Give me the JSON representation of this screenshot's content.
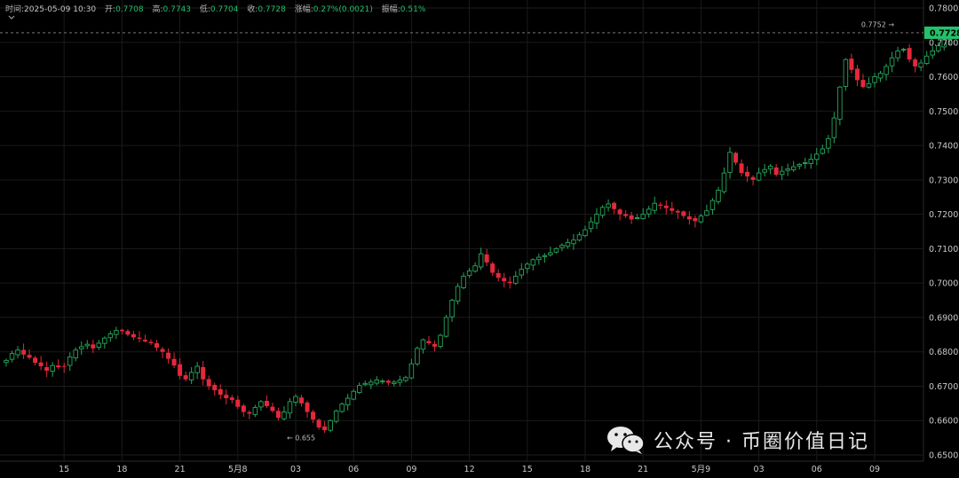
{
  "info_bar": {
    "time_label": "时间:",
    "time_value": "2025-05-09 10:30",
    "open_label": "开:",
    "open_value": "0.7708",
    "high_label": "高:",
    "high_value": "0.7743",
    "low_label": "低:",
    "low_value": "0.7704",
    "close_label": "收:",
    "close_value": "0.7728",
    "change_label": "涨幅:",
    "change_value": "0.27%(0.0021)",
    "amp_label": "振幅:",
    "amp_value": "0.51%"
  },
  "collapse_icon": "chevron-down-icon",
  "watermark": {
    "icon": "wechat-icon",
    "text": "公众号 · 币圈价值日记"
  },
  "colors": {
    "up": "#26a65b",
    "down": "#e3293a",
    "background": "#000000",
    "grid": "#1b1b1b",
    "axis_text": "#c8c8c8",
    "price_tag": "#26c06b"
  },
  "chart_data": {
    "type": "candlestick",
    "title": "",
    "xlabel": "",
    "ylabel": "",
    "ylim": [
      0.65,
      0.78
    ],
    "yticks": [
      "0.6500",
      "0.6600",
      "0.6700",
      "0.6800",
      "0.6900",
      "0.7000",
      "0.7100",
      "0.7200",
      "0.7300",
      "0.7400",
      "0.7500",
      "0.7600",
      "0.7700",
      "0.7800"
    ],
    "xticks": [
      {
        "label": "15",
        "index": 10
      },
      {
        "label": "18",
        "index": 20
      },
      {
        "label": "21",
        "index": 30
      },
      {
        "label": "5月8",
        "index": 40
      },
      {
        "label": "03",
        "index": 50
      },
      {
        "label": "06",
        "index": 60
      },
      {
        "label": "09",
        "index": 70
      },
      {
        "label": "12",
        "index": 80
      },
      {
        "label": "15",
        "index": 90
      },
      {
        "label": "18",
        "index": 100
      },
      {
        "label": "21",
        "index": 110
      },
      {
        "label": "5月9",
        "index": 120
      },
      {
        "label": "03",
        "index": 130
      },
      {
        "label": "06",
        "index": 140
      },
      {
        "label": "09",
        "index": 150
      }
    ],
    "current_price": "0.7728",
    "annotations": [
      {
        "text": "0.7752",
        "arrow": "→",
        "index": 154,
        "value": 0.7752
      },
      {
        "text": "0.655",
        "arrow": "←",
        "index": 48,
        "value": 0.655
      }
    ],
    "grid": true,
    "closes": [
      0.6775,
      0.6795,
      0.6805,
      0.6792,
      0.6783,
      0.6768,
      0.6758,
      0.6745,
      0.676,
      0.6755,
      0.6758,
      0.6785,
      0.6805,
      0.6815,
      0.6822,
      0.681,
      0.6825,
      0.684,
      0.6852,
      0.6862,
      0.686,
      0.685,
      0.6842,
      0.6838,
      0.683,
      0.6825,
      0.6812,
      0.68,
      0.678,
      0.676,
      0.673,
      0.672,
      0.674,
      0.6758,
      0.672,
      0.67,
      0.6688,
      0.6675,
      0.6665,
      0.666,
      0.664,
      0.6625,
      0.662,
      0.6638,
      0.6655,
      0.6642,
      0.6628,
      0.6608,
      0.6625,
      0.6655,
      0.667,
      0.665,
      0.6625,
      0.6603,
      0.658,
      0.6572,
      0.66,
      0.6628,
      0.6648,
      0.6665,
      0.6685,
      0.6702,
      0.6708,
      0.6712,
      0.6718,
      0.6715,
      0.671,
      0.6712,
      0.6718,
      0.6725,
      0.6765,
      0.681,
      0.6835,
      0.6825,
      0.6815,
      0.6848,
      0.69,
      0.695,
      0.699,
      0.702,
      0.7035,
      0.705,
      0.7085,
      0.706,
      0.703,
      0.7015,
      0.7005,
      0.7,
      0.702,
      0.704,
      0.7055,
      0.7068,
      0.7075,
      0.708,
      0.7088,
      0.71,
      0.711,
      0.7118,
      0.7125,
      0.714,
      0.7155,
      0.7178,
      0.72,
      0.722,
      0.723,
      0.7215,
      0.72,
      0.7195,
      0.7185,
      0.719,
      0.72,
      0.7215,
      0.7232,
      0.7225,
      0.7218,
      0.721,
      0.7205,
      0.7195,
      0.7185,
      0.718,
      0.7195,
      0.721,
      0.724,
      0.727,
      0.732,
      0.738,
      0.735,
      0.732,
      0.731,
      0.73,
      0.732,
      0.733,
      0.734,
      0.7315,
      0.7325,
      0.7332,
      0.7338,
      0.7345,
      0.735,
      0.736,
      0.7375,
      0.739,
      0.742,
      0.748,
      0.757,
      0.765,
      0.762,
      0.759,
      0.757,
      0.758,
      0.76,
      0.761,
      0.763,
      0.7655,
      0.7675,
      0.768,
      0.765,
      0.763,
      0.764,
      0.766,
      0.7675,
      0.769,
      0.7708,
      0.7728
    ]
  }
}
